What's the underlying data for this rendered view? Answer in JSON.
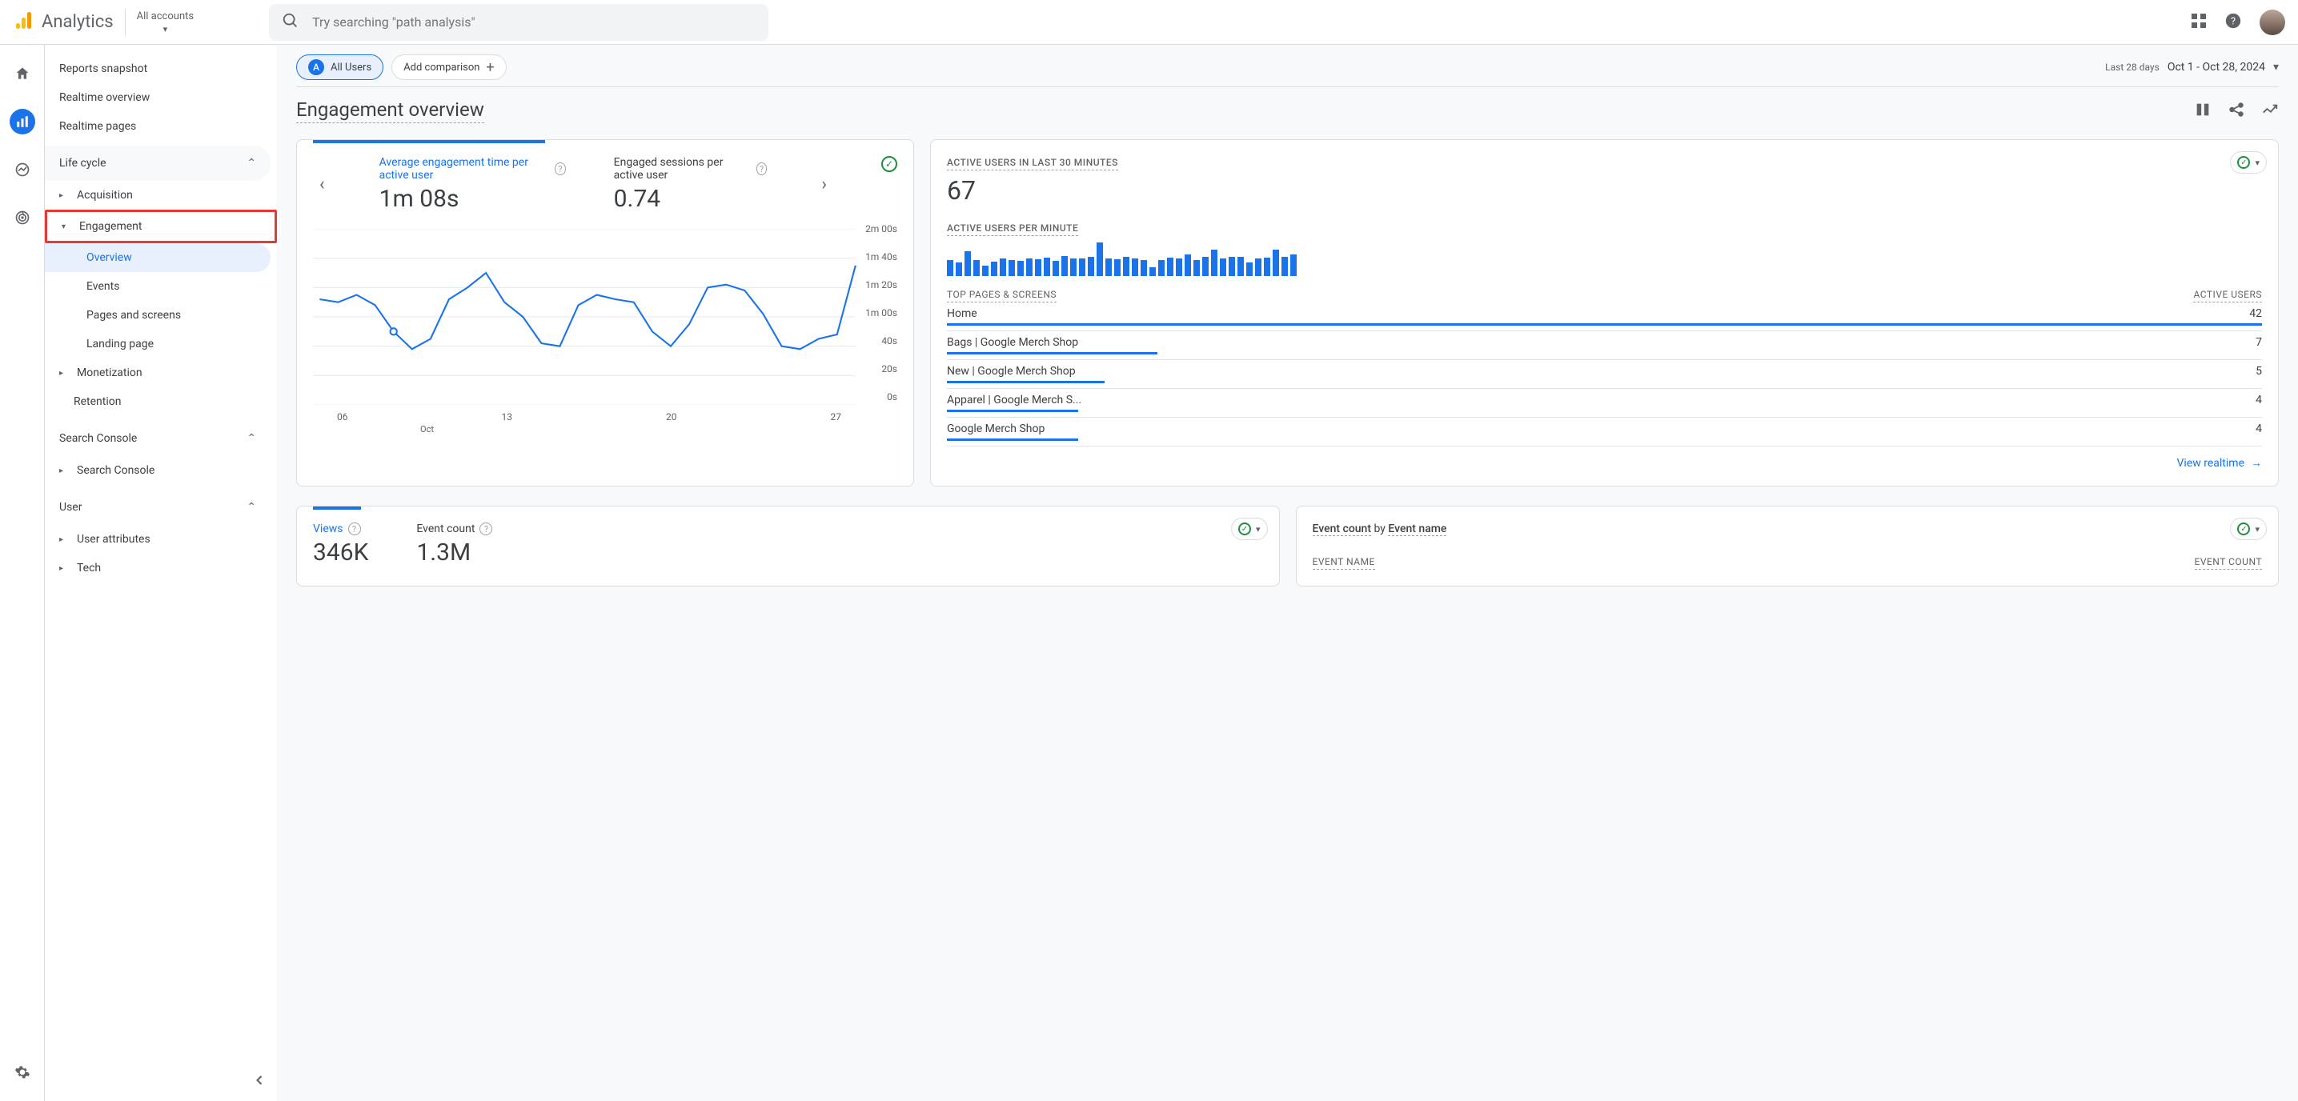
{
  "header": {
    "product": "Analytics",
    "accounts_label": "All accounts",
    "search_placeholder": "Try searching \"path analysis\""
  },
  "sidebar": {
    "items_top": [
      "Reports snapshot",
      "Realtime overview",
      "Realtime pages"
    ],
    "section_lifecycle": "Life cycle",
    "acquisition": "Acquisition",
    "engagement": "Engagement",
    "engagement_children": [
      "Overview",
      "Events",
      "Pages and screens",
      "Landing page"
    ],
    "monetization": "Monetization",
    "retention": "Retention",
    "section_search": "Search Console",
    "search_console": "Search Console",
    "section_user": "User",
    "user_attributes": "User attributes",
    "tech": "Tech"
  },
  "chips": {
    "all_users": "All Users",
    "add_comparison": "Add comparison"
  },
  "date": {
    "label": "Last 28 days",
    "range": "Oct 1 - Oct 28, 2024"
  },
  "page_title": "Engagement overview",
  "card1": {
    "metric_a": {
      "label": "Average engagement time per active user",
      "value": "1m 08s"
    },
    "metric_b": {
      "label": "Engaged sessions per active user",
      "value": "0.74"
    }
  },
  "chart_data": {
    "type": "line",
    "x": [
      1,
      2,
      3,
      4,
      5,
      6,
      7,
      8,
      9,
      10,
      11,
      12,
      13,
      14,
      15,
      16,
      17,
      18,
      19,
      20,
      21,
      22,
      23,
      24,
      25,
      26,
      27,
      28
    ],
    "values_s": [
      72,
      70,
      75,
      68,
      50,
      38,
      45,
      72,
      80,
      90,
      70,
      60,
      42,
      40,
      68,
      75,
      72,
      70,
      50,
      40,
      55,
      80,
      82,
      78,
      62,
      40,
      38,
      45,
      48,
      95
    ],
    "xlabel": "Oct",
    "xticks": [
      "06",
      "13",
      "20",
      "27"
    ],
    "yticks": [
      "2m 00s",
      "1m 40s",
      "1m 20s",
      "1m 00s",
      "40s",
      "20s",
      "0s"
    ],
    "ylim_s": [
      0,
      120
    ],
    "marker_index": 4
  },
  "realtime": {
    "h1": "ACTIVE USERS IN LAST 30 MINUTES",
    "value": "67",
    "h2": "ACTIVE USERS PER MINUTE",
    "bars": [
      18,
      15,
      28,
      18,
      12,
      16,
      20,
      18,
      17,
      20,
      19,
      21,
      17,
      23,
      20,
      20,
      22,
      38,
      20,
      19,
      22,
      20,
      18,
      10,
      18,
      21,
      20,
      24,
      18,
      22,
      30,
      20,
      22,
      22,
      15,
      20,
      21,
      30,
      22,
      24
    ],
    "col1": "TOP PAGES & SCREENS",
    "col2": "ACTIVE USERS",
    "rows": [
      {
        "name": "Home",
        "v": "42",
        "w": 100
      },
      {
        "name": "Bags | Google Merch Shop",
        "v": "7",
        "w": 16
      },
      {
        "name": "New | Google Merch Shop",
        "v": "5",
        "w": 12
      },
      {
        "name": "Apparel | Google Merch S...",
        "v": "4",
        "w": 10
      },
      {
        "name": "Google Merch Shop",
        "v": "4",
        "w": 10
      }
    ],
    "link": "View realtime"
  },
  "card2a": {
    "views_label": "Views",
    "views": "346K",
    "ec_label": "Event count",
    "ec": "1.3M"
  },
  "card2b": {
    "line": [
      "Event count",
      " by ",
      "Event name"
    ],
    "col1": "EVENT NAME",
    "col2": "EVENT COUNT"
  }
}
